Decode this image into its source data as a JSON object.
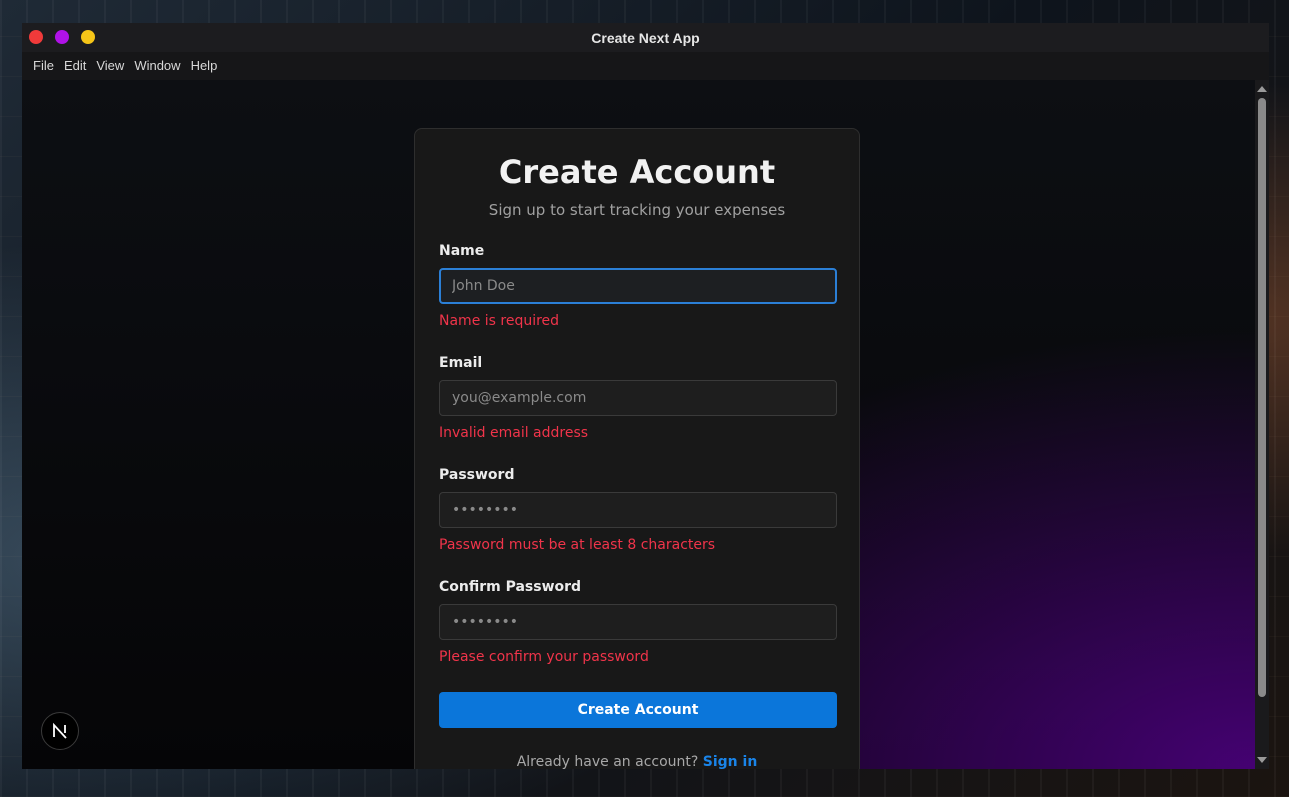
{
  "window": {
    "title": "Create Next App"
  },
  "menu": [
    "File",
    "Edit",
    "View",
    "Window",
    "Help"
  ],
  "form": {
    "title": "Create Account",
    "subtitle": "Sign up to start tracking your expenses",
    "fields": [
      {
        "label": "Name",
        "placeholder": "John Doe",
        "value": "",
        "error": "Name is required",
        "type": "text"
      },
      {
        "label": "Email",
        "placeholder": "you@example.com",
        "value": "",
        "error": "Invalid email address",
        "type": "email"
      },
      {
        "label": "Password",
        "placeholder": "••••••••",
        "value": "",
        "error": "Password must be at least 8 characters",
        "type": "password"
      },
      {
        "label": "Confirm Password",
        "placeholder": "••••••••",
        "value": "",
        "error": "Please confirm your password",
        "type": "password"
      }
    ],
    "submit_label": "Create Account",
    "footer_text": "Already have an account?",
    "signin_label": "Sign in"
  },
  "badge": {
    "letter": "N",
    "icon": "nextjs-logo-icon"
  },
  "colors": {
    "accent": "#0b76da",
    "error": "#f0344a",
    "link": "#1a84e8",
    "focus": "#2b7fd6"
  }
}
